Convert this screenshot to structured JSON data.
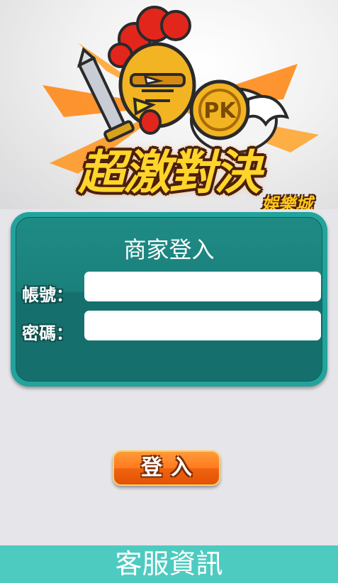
{
  "banner": {
    "title": "超激對決",
    "subtitle": "娛樂城",
    "coin_text": "PK"
  },
  "login": {
    "title": "商家登入",
    "account_label": "帳號：",
    "password_label": "密碼：",
    "account_value": "",
    "password_value": "",
    "button_label": "登入"
  },
  "footer": {
    "label": "客服資訊"
  },
  "colors": {
    "panel_border": "#22a39c",
    "panel_fill": "#1b807b",
    "button_orange": "#ff7a1e",
    "footer_teal": "#4ecbc0",
    "page_background": "#e6e5ea"
  }
}
